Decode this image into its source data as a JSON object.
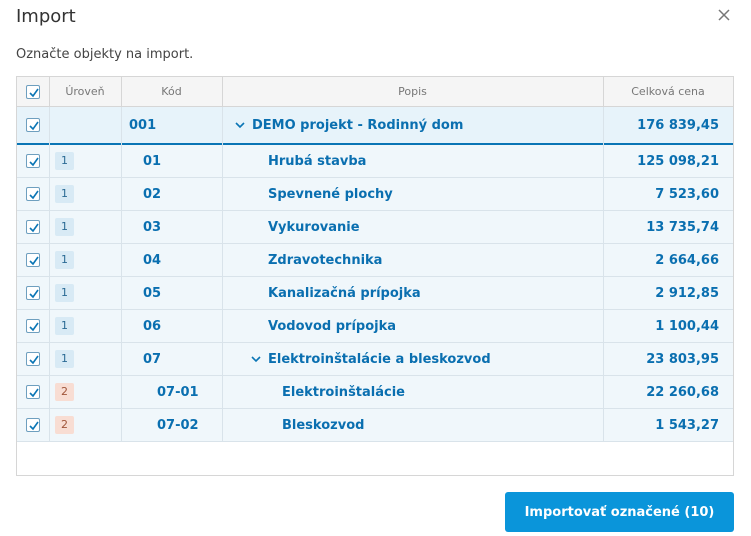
{
  "dialog": {
    "title": "Import",
    "subtitle": "Označte objekty na import.",
    "import_button": "Importovať označené (10)"
  },
  "columns": {
    "level": "Úroveň",
    "code": "Kód",
    "description": "Popis",
    "total_price": "Celková cena"
  },
  "rows": [
    {
      "level": "",
      "code": "001",
      "description": "DEMO projekt - Rodinný dom",
      "price": "176 839,45",
      "checked": true,
      "expandable": true
    },
    {
      "level": "1",
      "code": "01",
      "description": "Hrubá stavba",
      "price": "125 098,21",
      "checked": true,
      "expandable": false
    },
    {
      "level": "1",
      "code": "02",
      "description": "Spevnené plochy",
      "price": "7 523,60",
      "checked": true,
      "expandable": false
    },
    {
      "level": "1",
      "code": "03",
      "description": "Vykurovanie",
      "price": "13 735,74",
      "checked": true,
      "expandable": false
    },
    {
      "level": "1",
      "code": "04",
      "description": "Zdravotechnika",
      "price": "2 664,66",
      "checked": true,
      "expandable": false
    },
    {
      "level": "1",
      "code": "05",
      "description": "Kanalizačná prípojka",
      "price": "2 912,85",
      "checked": true,
      "expandable": false
    },
    {
      "level": "1",
      "code": "06",
      "description": "Vodovod prípojka",
      "price": "1 100,44",
      "checked": true,
      "expandable": false
    },
    {
      "level": "1",
      "code": "07",
      "description": "Elektroinštalácie a bleskozvod",
      "price": "23 803,95",
      "checked": true,
      "expandable": true
    },
    {
      "level": "2",
      "code": "07-01",
      "description": "Elektroinštalácie",
      "price": "22 260,68",
      "checked": true,
      "expandable": false
    },
    {
      "level": "2",
      "code": "07-02",
      "description": "Bleskozvod",
      "price": "1 543,27",
      "checked": true,
      "expandable": false
    }
  ],
  "colors": {
    "accent": "#0a95da",
    "link": "#0a6fb0",
    "row_bg": "#f0f7fb",
    "level1_badge": "#d8eaf5",
    "level2_badge": "#f8ddd3"
  }
}
